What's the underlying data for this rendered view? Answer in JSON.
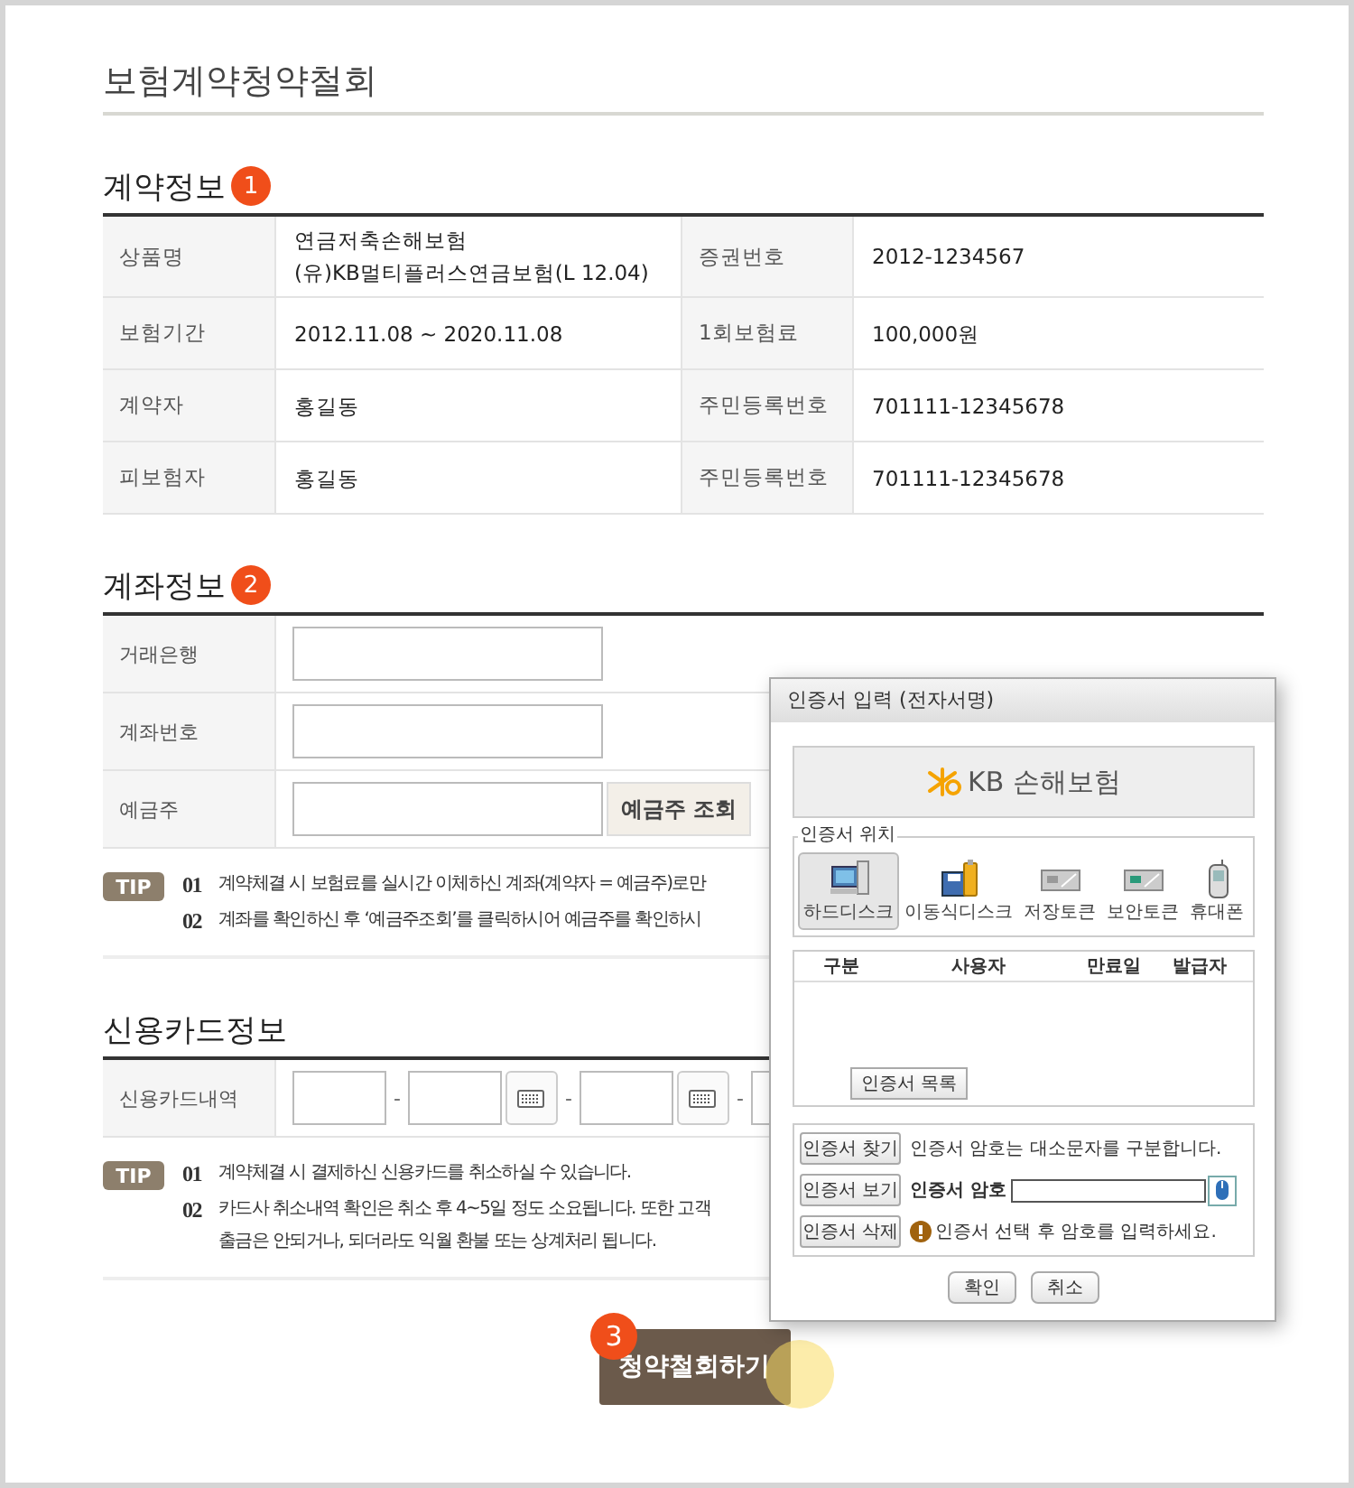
{
  "page_title": "보험계약청약철회",
  "contract": {
    "title": "계약정보",
    "badge": "1",
    "rows": [
      {
        "cells": [
          {
            "kind": "head",
            "lines": [
              "상품명"
            ]
          },
          {
            "kind": "data",
            "lines": [
              "연금저축손해보험",
              "(유)KB멀티플러스연금보험(L 12.04)"
            ]
          },
          {
            "kind": "head",
            "lines": [
              "증권번호"
            ]
          },
          {
            "kind": "data",
            "lines": [
              "2012-1234567"
            ]
          }
        ]
      },
      {
        "cells": [
          {
            "kind": "head",
            "lines": [
              "보험기간"
            ]
          },
          {
            "kind": "data",
            "lines": [
              "2012.11.08 ~ 2020.11.08"
            ]
          },
          {
            "kind": "head",
            "lines": [
              "1회보험료"
            ]
          },
          {
            "kind": "data",
            "lines": [
              "100,000원"
            ]
          }
        ]
      },
      {
        "cells": [
          {
            "kind": "head",
            "lines": [
              "계약자"
            ]
          },
          {
            "kind": "data",
            "lines": [
              "홍길동"
            ]
          },
          {
            "kind": "head",
            "lines": [
              "주민등록번호"
            ]
          },
          {
            "kind": "data",
            "lines": [
              "701111-12345678"
            ]
          }
        ]
      },
      {
        "cells": [
          {
            "kind": "head",
            "lines": [
              "피보험자"
            ]
          },
          {
            "kind": "data",
            "lines": [
              "홍길동"
            ]
          },
          {
            "kind": "head",
            "lines": [
              "주민등록번호"
            ]
          },
          {
            "kind": "data",
            "lines": [
              "701111-12345678"
            ]
          }
        ]
      }
    ]
  },
  "account": {
    "title": "계좌정보",
    "badge": "2",
    "rows": [
      {
        "label": "거래은행",
        "fields": [
          {
            "kind": "input"
          }
        ]
      },
      {
        "label": "계좌번호",
        "fields": [
          {
            "kind": "input"
          }
        ]
      },
      {
        "label": "예금주",
        "fields": [
          {
            "kind": "input"
          },
          {
            "kind": "button",
            "text": "예금주 조회"
          }
        ]
      }
    ],
    "tip": {
      "badge": "TIP",
      "items": [
        {
          "number": "01",
          "lines": [
            "계약체결 시 보험료를 실시간 이체하신 계좌(계약자 = 예금주)로만"
          ]
        },
        {
          "number": "02",
          "lines": [
            "계좌를 확인하신 후 ‘예금주조회’를 클릭하시어 예금주를 확인하시"
          ]
        }
      ]
    }
  },
  "card": {
    "title": "신용카드정보",
    "rows": [
      {
        "label": "신용카드내역",
        "fields": [
          {
            "kind": "short"
          },
          {
            "kind": "separator",
            "text": "-"
          },
          {
            "kind": "short"
          },
          {
            "kind": "keypad"
          },
          {
            "kind": "separator",
            "text": "-"
          },
          {
            "kind": "short"
          },
          {
            "kind": "keypad"
          },
          {
            "kind": "separator",
            "text": "-"
          },
          {
            "kind": "short"
          }
        ]
      }
    ],
    "tip": {
      "badge": "TIP",
      "items": [
        {
          "number": "01",
          "lines": [
            "계약체결 시 결제하신 신용카드를 취소하실 수 있습니다."
          ]
        },
        {
          "number": "02",
          "lines": [
            "카드사 취소내역 확인은 취소 후 4~5일 정도 소요됩니다. 또한 고객",
            "출금은 안되거나, 되더라도 익월 환불 또는 상계처리 됩니다."
          ]
        }
      ]
    }
  },
  "submit": {
    "label": "청약철회하기",
    "badge": "3"
  },
  "dialog": {
    "title": "인증서 입력 (전자서명)",
    "brand": "KB 손해보험",
    "location": {
      "legend": "인증서 위치",
      "options": [
        {
          "label": "하드디스크",
          "kind": "harddisk",
          "selected": true
        },
        {
          "label": "이동식디스크",
          "kind": "removable",
          "selected": false
        },
        {
          "label": "저장토큰",
          "kind": "storage_token",
          "selected": false
        },
        {
          "label": "보안토큰",
          "kind": "security_token",
          "selected": false
        },
        {
          "label": "휴대폰",
          "kind": "phone",
          "selected": false
        }
      ]
    },
    "cert_list": {
      "columns": [
        "구분",
        "사용자",
        "만료일",
        "발급자"
      ],
      "button": "인증서 목록"
    },
    "actions": [
      {
        "button": "인증서 찾기",
        "kind": "note",
        "text": "인증서 암호는 대소문자를 구분합니다."
      },
      {
        "button": "인증서 보기",
        "kind": "password",
        "text": "인증서 암호"
      },
      {
        "button": "인증서 삭제",
        "kind": "warning",
        "text": "인증서 선택 후 암호를 입력하세요."
      }
    ],
    "buttons": [
      "확인",
      "취소"
    ]
  }
}
